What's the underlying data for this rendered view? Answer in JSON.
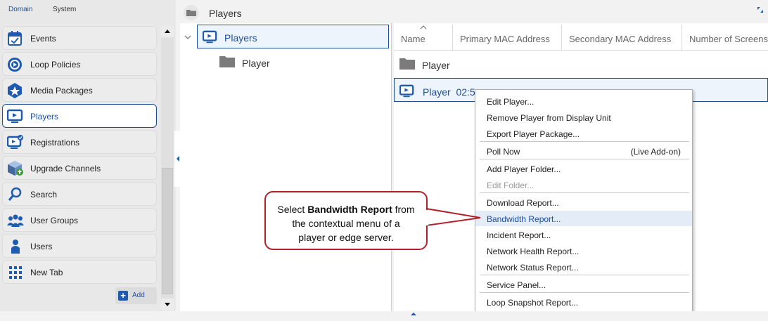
{
  "sidebar": {
    "tabs": [
      {
        "label": "Domain"
      },
      {
        "label": "System"
      }
    ],
    "items": [
      {
        "label": "Events",
        "icon": "calendar-icon"
      },
      {
        "label": "Loop Policies",
        "icon": "loop-icon"
      },
      {
        "label": "Media Packages",
        "icon": "star-badge-icon"
      },
      {
        "label": "Players",
        "icon": "monitor-play-icon",
        "active": true
      },
      {
        "label": "Registrations",
        "icon": "monitor-check-icon"
      },
      {
        "label": "Upgrade Channels",
        "icon": "cube-upgrade-icon"
      },
      {
        "label": "Search",
        "icon": "search-icon"
      },
      {
        "label": "User Groups",
        "icon": "users-icon"
      },
      {
        "label": "Users",
        "icon": "user-icon"
      },
      {
        "label": "New Tab",
        "icon": "grid-icon"
      }
    ],
    "add_label": "Add"
  },
  "header": {
    "title": "Players"
  },
  "tree": {
    "root_label": "Players",
    "child_label": "Player"
  },
  "grid": {
    "columns": [
      "Name",
      "Primary MAC Address",
      "Secondary MAC Address",
      "Number of Screens"
    ],
    "rows": [
      {
        "label": "Player",
        "icon": "folder-icon"
      },
      {
        "label": "Player  02:5",
        "icon": "monitor-play-icon"
      }
    ]
  },
  "context_menu": {
    "items": [
      {
        "label": "Edit Player..."
      },
      {
        "label": "Remove Player from Display Unit"
      },
      {
        "label": "Export Player Package..."
      },
      {
        "label": "Poll Now",
        "shortcut": "(Live Add-on)"
      },
      {
        "label": "Add Player Folder..."
      },
      {
        "label": "Edit Folder...",
        "disabled": true
      },
      {
        "label": "Download Report..."
      },
      {
        "label": "Bandwidth Report...",
        "highlighted": true
      },
      {
        "label": "Incident Report..."
      },
      {
        "label": "Network Health Report..."
      },
      {
        "label": "Network Status Report..."
      },
      {
        "label": "Service Panel..."
      },
      {
        "label": "Loop Snapshot Report..."
      }
    ]
  },
  "callout": {
    "prefix": "Select ",
    "bold": "Bandwidth Report",
    "suffix": " from",
    "line2": "the contextual menu of a",
    "line3": "player or edge server."
  },
  "colors": {
    "accent": "#1f4f94",
    "callout_border": "#b0212b",
    "highlight": "#e4ecf7"
  }
}
